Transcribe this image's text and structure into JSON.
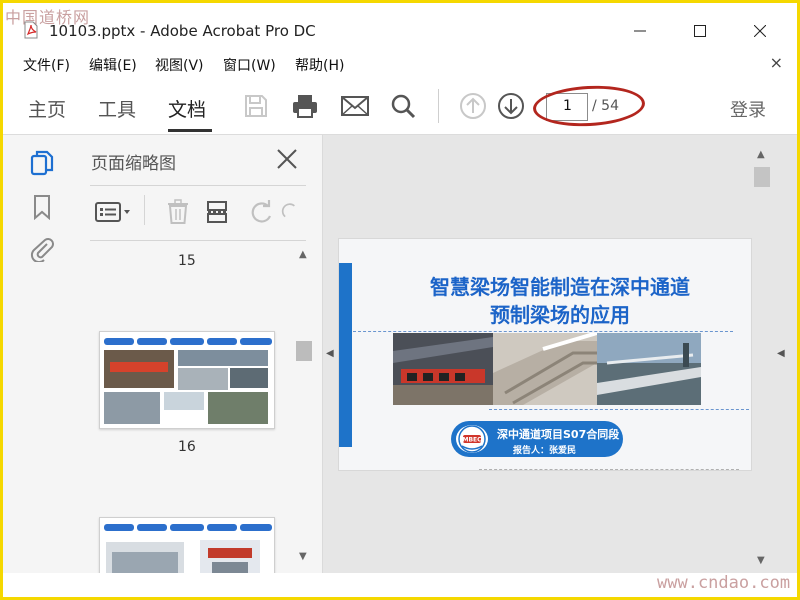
{
  "window": {
    "title": "10103.pptx - Adobe Acrobat Pro DC",
    "watermark_top": "中国道桥网",
    "watermark_bottom": "www.cndao.com"
  },
  "menu": {
    "items": [
      {
        "label": "文件(F)"
      },
      {
        "label": "编辑(E)"
      },
      {
        "label": "视图(V)"
      },
      {
        "label": "窗口(W)"
      },
      {
        "label": "帮助(H)"
      }
    ],
    "close_glyph": "×"
  },
  "toolbar": {
    "tabs": [
      {
        "label": "主页",
        "active": false
      },
      {
        "label": "工具",
        "active": false
      },
      {
        "label": "文档",
        "active": true
      }
    ],
    "icons": [
      "save-icon",
      "print-icon",
      "email-icon",
      "search-icon",
      "prev-page-icon",
      "next-page-icon"
    ],
    "page_current": "1",
    "page_total": "/ 54",
    "login_label": "登录",
    "highlight_color": "#b3261e"
  },
  "thumbnail_panel": {
    "title": "页面缩略图",
    "pages": [
      {
        "number": "15"
      },
      {
        "number": "16"
      }
    ]
  },
  "slide": {
    "title_line1": "智慧梁场智能制造在深中通道",
    "title_line2": "预制梁场的应用",
    "subtitle": "深中通道项目S07合同段",
    "reporter": "报告人：张爱民",
    "logo_text": "MBEC",
    "accent_color": "#1e73c9"
  }
}
